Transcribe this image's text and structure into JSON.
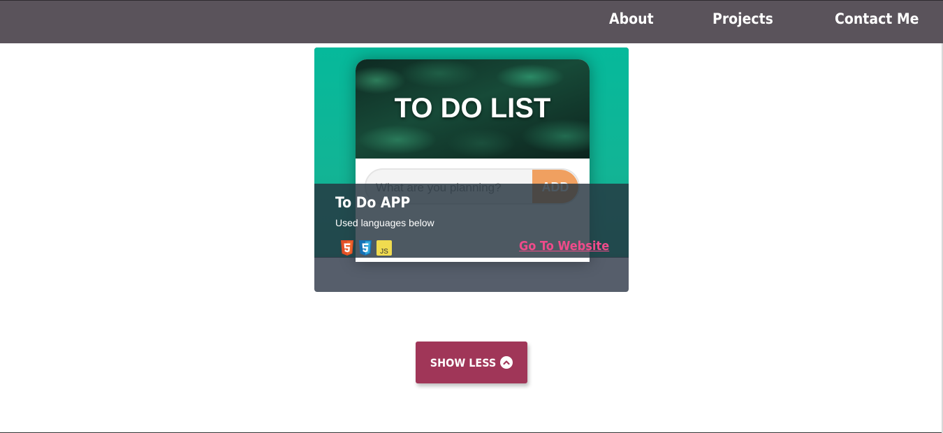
{
  "nav": {
    "about": "About",
    "projects": "Projects",
    "contact": "Contact Me"
  },
  "project": {
    "preview": {
      "title": "TO DO LIST",
      "input_placeholder": "What are you planning?",
      "add_label": "ADD"
    },
    "name": "To Do APP",
    "subtitle": "Used languages below",
    "languages": [
      "html5-icon",
      "css3-icon",
      "js-icon"
    ],
    "js_label": "JS",
    "link_label": "Go To Website"
  },
  "show_less": {
    "label": "SHOW LESS",
    "icon": "chevron-up-circle-icon"
  },
  "colors": {
    "navbar": "#5a535b",
    "card_bg": "#565e6b",
    "preview_accent": "#06b99b",
    "link": "#ef4b8a",
    "button": "#a03658",
    "html5": "#e34f26",
    "css3": "#2196f3",
    "js": "#f0db4f"
  }
}
